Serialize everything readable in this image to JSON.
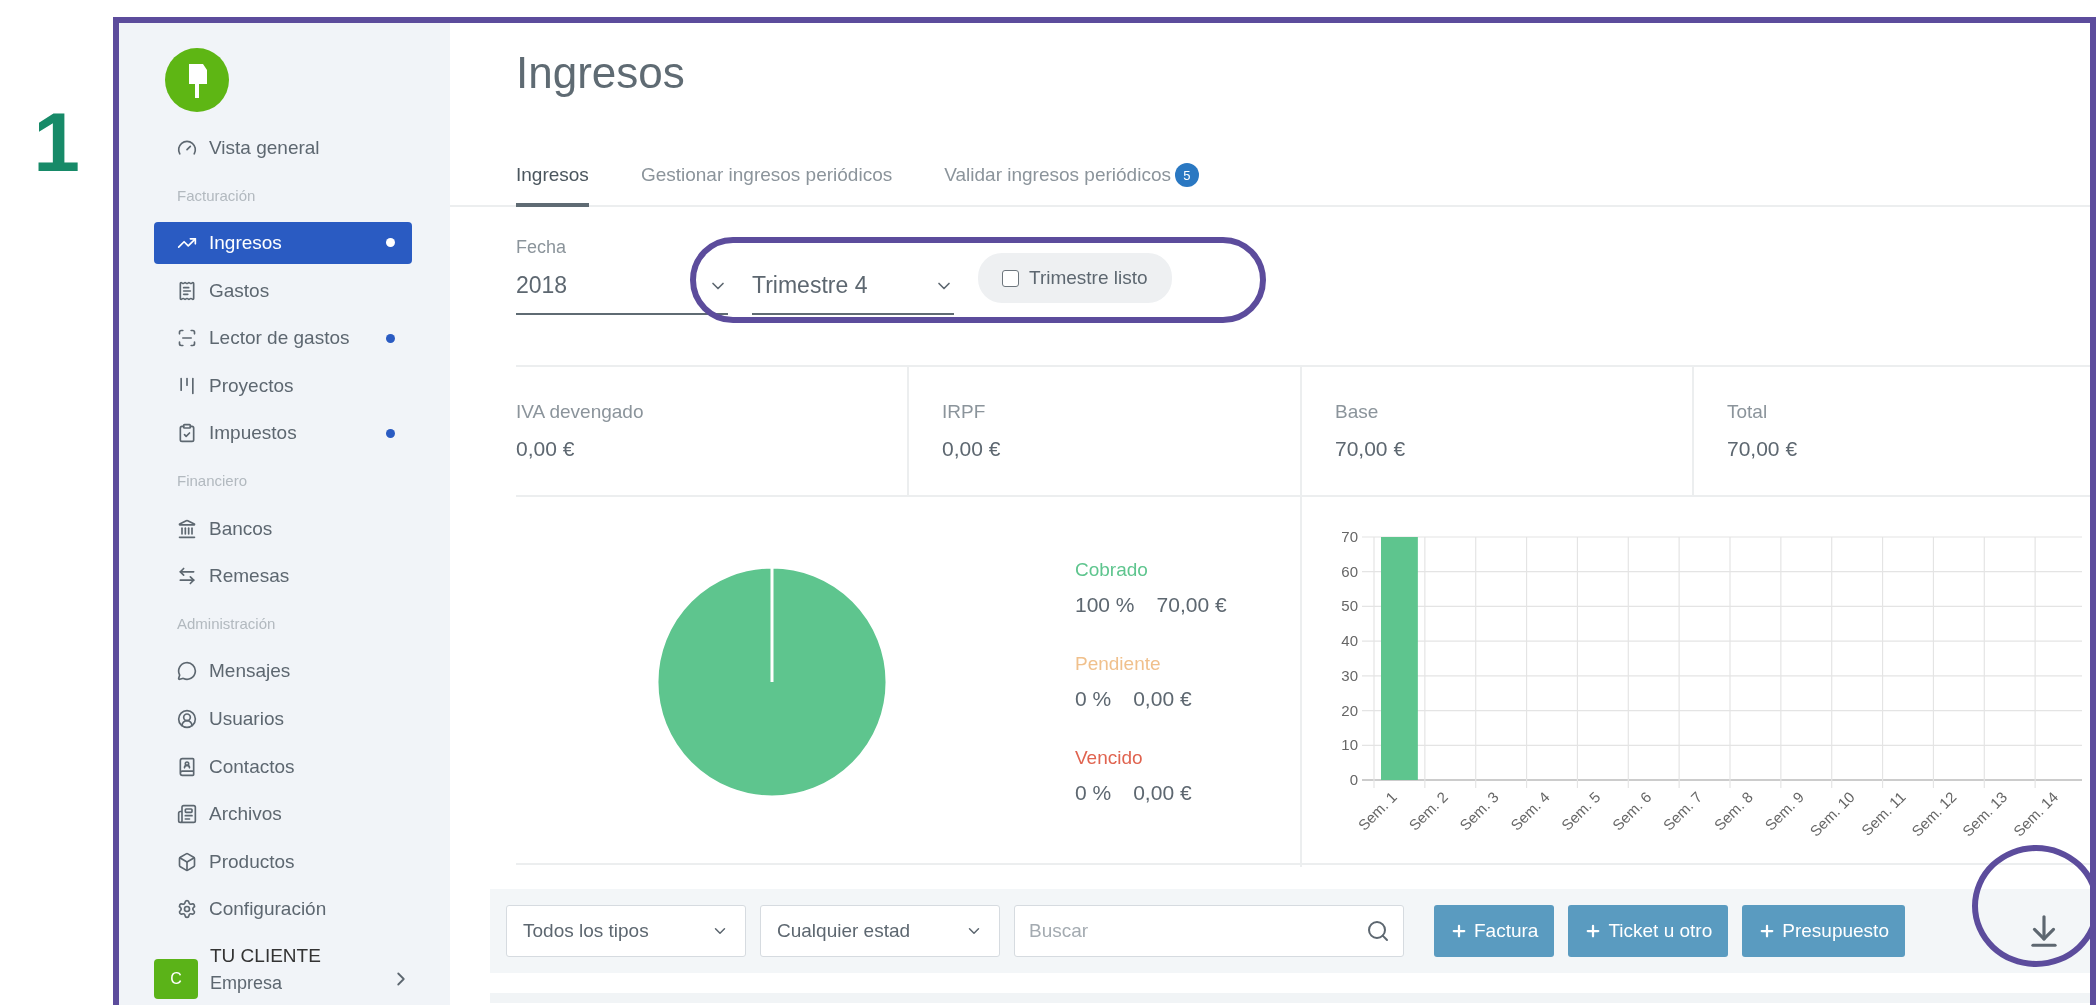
{
  "annotation": {
    "step_number": "1"
  },
  "sidebar": {
    "items": [
      {
        "kind": "link",
        "label": "Vista general",
        "selected": false,
        "dot": false
      },
      {
        "kind": "section",
        "label": "Facturación"
      },
      {
        "kind": "link",
        "label": "Ingresos",
        "selected": true,
        "dot": true
      },
      {
        "kind": "link",
        "label": "Gastos",
        "selected": false,
        "dot": false
      },
      {
        "kind": "link",
        "label": "Lector de gastos",
        "selected": false,
        "dot": true
      },
      {
        "kind": "link",
        "label": "Proyectos",
        "selected": false,
        "dot": false
      },
      {
        "kind": "link",
        "label": "Impuestos",
        "selected": false,
        "dot": true
      },
      {
        "kind": "section",
        "label": "Financiero"
      },
      {
        "kind": "link",
        "label": "Bancos",
        "selected": false,
        "dot": false
      },
      {
        "kind": "link",
        "label": "Remesas",
        "selected": false,
        "dot": false
      },
      {
        "kind": "section",
        "label": "Administración"
      },
      {
        "kind": "link",
        "label": "Mensajes",
        "selected": false,
        "dot": false
      },
      {
        "kind": "link",
        "label": "Usuarios",
        "selected": false,
        "dot": false
      },
      {
        "kind": "link",
        "label": "Contactos",
        "selected": false,
        "dot": false
      },
      {
        "kind": "link",
        "label": "Archivos",
        "selected": false,
        "dot": false
      },
      {
        "kind": "link",
        "label": "Productos",
        "selected": false,
        "dot": false
      },
      {
        "kind": "link",
        "label": "Configuración",
        "selected": false,
        "dot": false
      }
    ],
    "account": {
      "avatar": "C",
      "name": "TU CLIENTE",
      "role": "Empresa"
    }
  },
  "page": {
    "title": "Ingresos"
  },
  "tabs": [
    {
      "label": "Ingresos",
      "selected": true
    },
    {
      "label": "Gestionar ingresos periódicos",
      "selected": false
    },
    {
      "label": "Validar ingresos periódicos",
      "selected": false,
      "badge": "5"
    }
  ],
  "filters": {
    "date_label": "Fecha",
    "year": "2018",
    "quarter": "Trimestre 4",
    "quarter_ready": {
      "label": "Trimestre listo",
      "checked": false
    }
  },
  "stats": [
    {
      "label": "IVA devengado",
      "value": "0,00 €"
    },
    {
      "label": "IRPF",
      "value": "0,00 €"
    },
    {
      "label": "Base",
      "value": "70,00 €"
    },
    {
      "label": "Total",
      "value": "70,00 €"
    }
  ],
  "status_breakdown": {
    "items": [
      {
        "label": "Cobrado",
        "percent": "100 %",
        "amount": "70,00 €",
        "color": "#5ec58e"
      },
      {
        "label": "Pendiente",
        "percent": "0 %",
        "amount": "0,00 €",
        "color": "#f0c08c"
      },
      {
        "label": "Vencido",
        "percent": "0 %",
        "amount": "0,00 €",
        "color": "#e0634f"
      }
    ],
    "chart_data": {
      "type": "pie",
      "values": [
        100,
        0,
        0
      ]
    }
  },
  "weekly_chart": {
    "chart_data": {
      "type": "bar",
      "categories": [
        "Sem. 1",
        "Sem. 2",
        "Sem. 3",
        "Sem. 4",
        "Sem. 5",
        "Sem. 6",
        "Sem. 7",
        "Sem. 8",
        "Sem. 9",
        "Sem. 10",
        "Sem. 11",
        "Sem. 12",
        "Sem. 13",
        "Sem. 14"
      ],
      "values": [
        70,
        0,
        0,
        0,
        0,
        0,
        0,
        0,
        0,
        0,
        0,
        0,
        0,
        0
      ],
      "grid": true,
      "ylim": [
        0,
        70
      ],
      "yticks": [
        0,
        10,
        20,
        30,
        40,
        50,
        60,
        70
      ]
    }
  },
  "toolbar": {
    "type_filter": "Todos los tipos",
    "status_filter": "Cualquier estad",
    "search": {
      "placeholder": "Buscar"
    },
    "buttons": [
      "Factura",
      "Ticket u otro",
      "Presupuesto"
    ]
  }
}
